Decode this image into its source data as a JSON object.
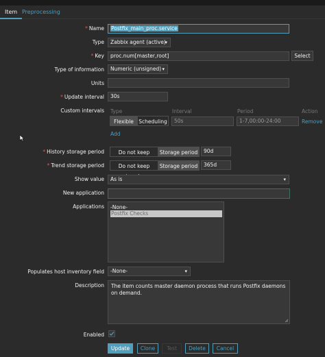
{
  "tabs": {
    "item": "Item",
    "preprocessing": "Preprocessing"
  },
  "form": {
    "name_label": "Name",
    "name_value": "Postfix_main_proc.service",
    "type_label": "Type",
    "type_value": "Zabbix agent (active)",
    "key_label": "Key",
    "key_value": "proc.num[master,root]",
    "key_select": "Select",
    "info_label": "Type of information",
    "info_value": "Numeric (unsigned)",
    "units_label": "Units",
    "units_value": "",
    "interval_label": "Update interval",
    "interval_value": "30s",
    "custom_label": "Custom intervals",
    "custom_cols": {
      "type": "Type",
      "interval": "Interval",
      "period": "Period",
      "action": "Action"
    },
    "custom_row": {
      "flexible": "Flexible",
      "scheduling": "Scheduling",
      "interval": "50s",
      "period": "1-7,00:00-24:00",
      "remove": "Remove"
    },
    "custom_add": "Add",
    "history_label": "History storage period",
    "history_opt1": "Do not keep history",
    "history_opt2": "Storage period",
    "history_value": "90d",
    "trend_label": "Trend storage period",
    "trend_opt1": "Do not keep trends",
    "trend_opt2": "Storage period",
    "trend_value": "365d",
    "show_label": "Show value",
    "show_value": "As is",
    "newapp_label": "New application",
    "newapp_value": "",
    "apps_label": "Applications",
    "apps_items": [
      "-None-",
      "Postfix Checks"
    ],
    "inventory_label": "Populates host inventory field",
    "inventory_value": "-None-",
    "desc_label": "Description",
    "desc_value": "The item counts master daemon process that runs Postfix daemons on demand.",
    "enabled_label": "Enabled",
    "enabled_checked": true,
    "buttons": {
      "update": "Update",
      "clone": "Clone",
      "test": "Test",
      "delete": "Delete",
      "cancel": "Cancel"
    }
  },
  "colors": {
    "accent": "#4f9fbd",
    "required": "#e45959",
    "background": "#2b2b2b",
    "field": "#383838"
  },
  "icons": {
    "caret": "chevron-down-icon",
    "check": "check-icon",
    "cursor": "mouse-pointer-icon",
    "resize": "resize-handle-icon"
  }
}
